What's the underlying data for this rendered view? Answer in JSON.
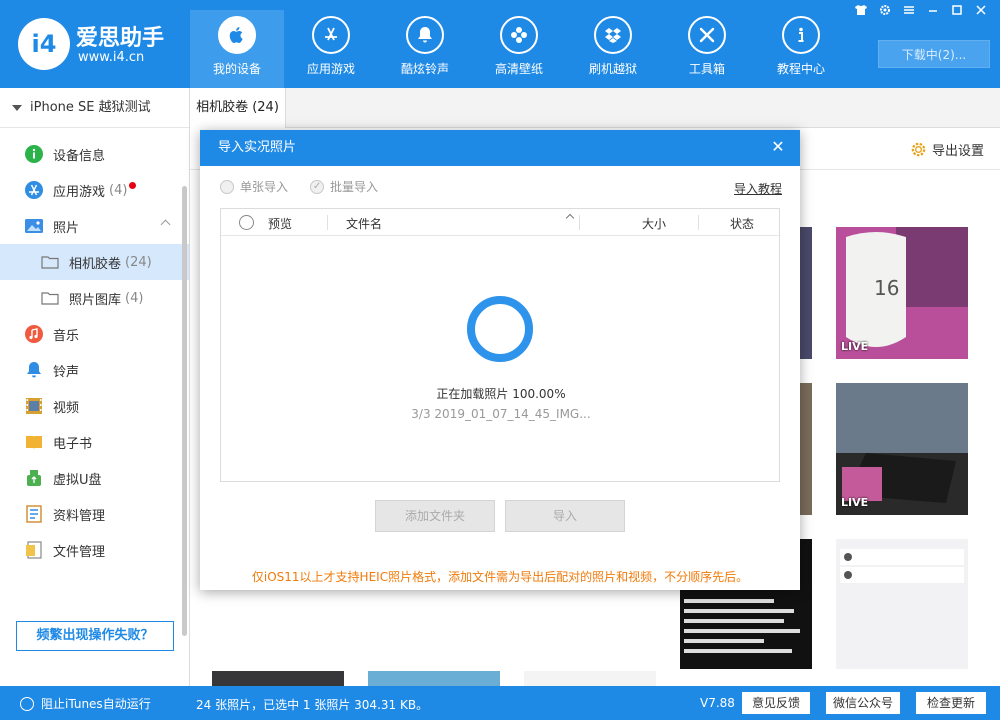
{
  "app": {
    "logo_mark": "i4",
    "logo_name": "爱思助手",
    "logo_url": "www.i4.cn"
  },
  "nav": [
    {
      "label": "我的设备",
      "icon": "apple-icon",
      "active": true
    },
    {
      "label": "应用游戏",
      "icon": "app-store-icon",
      "active": false
    },
    {
      "label": "酷炫铃声",
      "icon": "bell-icon",
      "active": false
    },
    {
      "label": "高清壁纸",
      "icon": "flower-icon",
      "active": false
    },
    {
      "label": "刷机越狱",
      "icon": "dropbox-icon",
      "active": false
    },
    {
      "label": "工具箱",
      "icon": "tools-icon",
      "active": false
    },
    {
      "label": "教程中心",
      "icon": "info-icon",
      "active": false
    }
  ],
  "window": {
    "download_label": "下载中(2)...",
    "controls": [
      "shirt-icon",
      "gear-icon",
      "menu-icon",
      "minimize-icon",
      "maximize-icon",
      "close-icon"
    ]
  },
  "sidebar": {
    "device_name": "iPhone SE 越狱测试",
    "items": [
      {
        "label": "设备信息",
        "icon": "info-circle-icon",
        "count": "",
        "sub": false
      },
      {
        "label": "应用游戏",
        "icon": "app-store-icon",
        "count": "(4)",
        "sub": false,
        "dot": true
      },
      {
        "label": "照片",
        "icon": "photo-icon",
        "count": "",
        "sub": false,
        "expanded": true
      },
      {
        "label": "相机胶卷",
        "icon": "folder-icon",
        "count": "(24)",
        "sub": true,
        "selected": true
      },
      {
        "label": "照片图库",
        "icon": "folder-icon",
        "count": "(4)",
        "sub": true
      },
      {
        "label": "音乐",
        "icon": "music-icon",
        "count": "",
        "sub": false
      },
      {
        "label": "铃声",
        "icon": "bell-icon",
        "count": "",
        "sub": false
      },
      {
        "label": "视频",
        "icon": "film-icon",
        "count": "",
        "sub": false
      },
      {
        "label": "电子书",
        "icon": "book-icon",
        "count": "",
        "sub": false
      },
      {
        "label": "虚拟U盘",
        "icon": "usb-icon",
        "count": "",
        "sub": false
      },
      {
        "label": "资料管理",
        "icon": "contacts-icon",
        "count": "",
        "sub": false
      },
      {
        "label": "文件管理",
        "icon": "file-icon",
        "count": "",
        "sub": false
      }
    ],
    "help_label": "频繁出现操作失败？"
  },
  "main": {
    "tab_label": "相机胶卷 (24)",
    "export_settings_label": "导出设置",
    "live_badge": "LIVE"
  },
  "dialog": {
    "title": "导入实况照片",
    "close_glyph": "✕",
    "mode_single": "单张导入",
    "mode_batch": "批量导入",
    "tutorial_label": "导入教程",
    "columns": {
      "preview": "预览",
      "filename": "文件名",
      "size": "大小",
      "status": "状态"
    },
    "loading_text": "正在加载照片 100.00%",
    "loading_file": "3/3 2019_01_07_14_45_IMG...",
    "progress": 1.0,
    "add_folder_label": "添加文件夹",
    "import_label": "导入",
    "note": "仅iOS11以上才支持HEIC照片格式，添加文件需为导出后配对的照片和视频，不分顺序先后。"
  },
  "status": {
    "itunes_label": "阻止iTunes自动运行",
    "summary": "24 张照片，已选中 1 张照片 304.31 KB。",
    "version": "V7.88",
    "feedback_label": "意见反馈",
    "wechat_label": "微信公众号",
    "update_label": "检查更新"
  },
  "colors": {
    "brand_blue": "#1f8ae6",
    "accent_orange": "#f07b0b",
    "badge_red": "#e60012"
  }
}
